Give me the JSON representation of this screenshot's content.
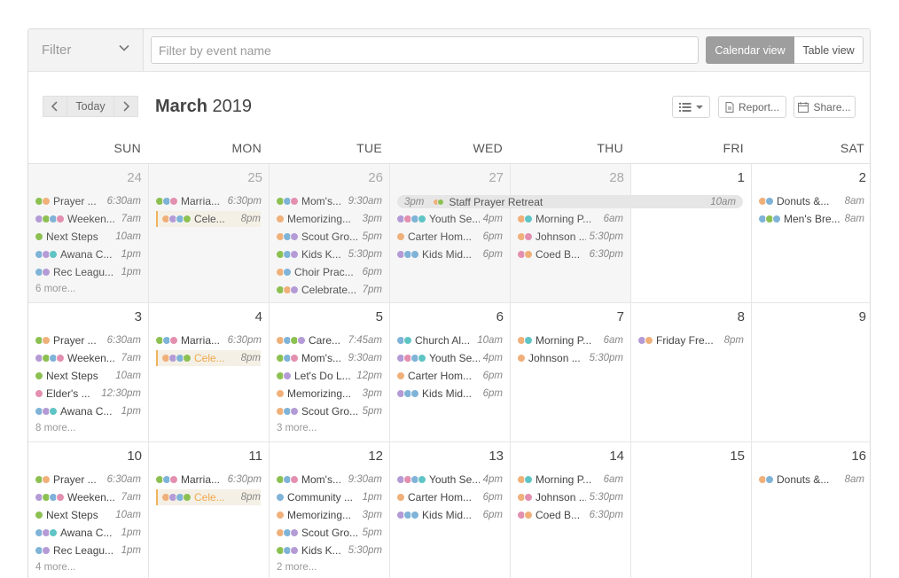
{
  "filter": {
    "label": "Filter",
    "placeholder": "Filter by event name"
  },
  "views": {
    "calendar": "Calendar view",
    "table": "Table view"
  },
  "nav": {
    "prev": "‹",
    "today": "Today",
    "next": "›"
  },
  "month": {
    "name": "March",
    "year": "2019"
  },
  "tools": {
    "list": "≡",
    "report": "Report...",
    "share": "Share..."
  },
  "weekdays": [
    "SUN",
    "MON",
    "TUE",
    "WED",
    "THU",
    "FRI",
    "SAT"
  ],
  "colors": {
    "green": "#8cc152",
    "blue": "#7fb3d8",
    "orange": "#f0b07a",
    "purple": "#b49bd6",
    "teal": "#5fc4c4",
    "pink": "#e38fb0",
    "gray": "#b8b8b8",
    "highlight": "#f0a84a"
  },
  "weeks": [
    {
      "days": [
        {
          "num": "24",
          "past": true,
          "events": [
            {
              "t": "Prayer ...",
              "time": "6:30am",
              "c": [
                "green",
                "orange"
              ]
            },
            {
              "t": "Weeken...",
              "time": "7am",
              "c": [
                "purple",
                "green",
                "blue",
                "pink"
              ]
            },
            {
              "t": "Next Steps",
              "time": "10am",
              "c": [
                "green"
              ]
            },
            {
              "t": "Awana C...",
              "time": "1pm",
              "c": [
                "blue",
                "purple",
                "teal"
              ]
            },
            {
              "t": "Rec Leagu...",
              "time": "1pm",
              "c": [
                "blue",
                "purple"
              ]
            }
          ],
          "more": "6 more..."
        },
        {
          "num": "25",
          "past": true,
          "events": [
            {
              "t": "Marria...",
              "time": "6:30pm",
              "c": [
                "green",
                "blue",
                "pink"
              ]
            },
            {
              "t": "Cele...",
              "time": "8pm",
              "c": [
                "orange",
                "purple",
                "blue",
                "green"
              ],
              "hl": true
            }
          ]
        },
        {
          "num": "26",
          "past": true,
          "events": [
            {
              "t": "Mom's...",
              "time": "9:30am",
              "c": [
                "green",
                "blue",
                "pink"
              ]
            },
            {
              "t": "Memorizing...",
              "time": "3pm",
              "c": [
                "orange"
              ]
            },
            {
              "t": "Scout Gro...",
              "time": "5pm",
              "c": [
                "orange",
                "blue",
                "purple"
              ]
            },
            {
              "t": "Kids K...",
              "time": "5:30pm",
              "c": [
                "green",
                "blue",
                "purple"
              ]
            },
            {
              "t": "Choir Prac...",
              "time": "6pm",
              "c": [
                "orange",
                "blue"
              ]
            },
            {
              "t": "Celebrate...",
              "time": "7pm",
              "c": [
                "green",
                "orange",
                "purple"
              ]
            }
          ]
        },
        {
          "num": "27",
          "past": true,
          "events": [
            {
              "t": "",
              "time": "",
              "c": []
            },
            {
              "t": "Youth Se...",
              "time": "4pm",
              "c": [
                "purple",
                "pink",
                "blue",
                "teal"
              ]
            },
            {
              "t": "Carter Hom...",
              "time": "6pm",
              "c": [
                "orange"
              ]
            },
            {
              "t": "Kids Mid...",
              "time": "6pm",
              "c": [
                "purple",
                "blue",
                "blue"
              ]
            }
          ]
        },
        {
          "num": "28",
          "past": true,
          "events": [
            {
              "t": "",
              "time": "",
              "c": []
            },
            {
              "t": "Morning P...",
              "time": "6am",
              "c": [
                "orange",
                "teal"
              ]
            },
            {
              "t": "Johnson ...",
              "time": "5:30pm",
              "c": [
                "orange",
                "pink"
              ]
            },
            {
              "t": "Coed B...",
              "time": "6:30pm",
              "c": [
                "pink",
                "orange"
              ]
            }
          ]
        },
        {
          "num": "1",
          "past": false,
          "events": []
        },
        {
          "num": "2",
          "past": false,
          "events": [
            {
              "t": "Donuts &...",
              "time": "8am",
              "c": [
                "orange",
                "blue"
              ]
            },
            {
              "t": "Men's Bre...",
              "time": "8am",
              "c": [
                "blue",
                "green",
                "blue"
              ]
            }
          ]
        }
      ]
    },
    {
      "days": [
        {
          "num": "3",
          "past": false,
          "events": [
            {
              "t": "Prayer ...",
              "time": "6:30am",
              "c": [
                "green",
                "orange"
              ]
            },
            {
              "t": "Weeken...",
              "time": "7am",
              "c": [
                "purple",
                "green",
                "blue",
                "pink"
              ]
            },
            {
              "t": "Next Steps",
              "time": "10am",
              "c": [
                "green"
              ]
            },
            {
              "t": "Elder's ...",
              "time": "12:30pm",
              "c": [
                "pink"
              ]
            },
            {
              "t": "Awana C...",
              "time": "1pm",
              "c": [
                "blue",
                "purple",
                "teal"
              ]
            }
          ],
          "more": "8 more..."
        },
        {
          "num": "4",
          "past": false,
          "events": [
            {
              "t": "Marria...",
              "time": "6:30pm",
              "c": [
                "green",
                "blue",
                "pink"
              ]
            },
            {
              "t": "Cele...",
              "time": "8pm",
              "c": [
                "orange",
                "purple",
                "blue",
                "green"
              ],
              "hl": true
            }
          ]
        },
        {
          "num": "5",
          "past": false,
          "events": [
            {
              "t": "Care...",
              "time": "7:45am",
              "c": [
                "orange",
                "blue",
                "green",
                "purple"
              ]
            },
            {
              "t": "Mom's...",
              "time": "9:30am",
              "c": [
                "green",
                "blue",
                "pink"
              ]
            },
            {
              "t": "Let's Do L...",
              "time": "12pm",
              "c": [
                "green",
                "purple"
              ]
            },
            {
              "t": "Memorizing...",
              "time": "3pm",
              "c": [
                "orange"
              ]
            },
            {
              "t": "Scout Gro...",
              "time": "5pm",
              "c": [
                "orange",
                "blue",
                "purple"
              ]
            }
          ],
          "more": "3 more..."
        },
        {
          "num": "6",
          "past": false,
          "events": [
            {
              "t": "Church Al...",
              "time": "10am",
              "c": [
                "blue",
                "teal"
              ]
            },
            {
              "t": "Youth Se...",
              "time": "4pm",
              "c": [
                "purple",
                "pink",
                "blue",
                "teal"
              ]
            },
            {
              "t": "Carter Hom...",
              "time": "6pm",
              "c": [
                "orange"
              ]
            },
            {
              "t": "Kids Mid...",
              "time": "6pm",
              "c": [
                "purple",
                "blue",
                "blue"
              ]
            }
          ]
        },
        {
          "num": "7",
          "past": false,
          "events": [
            {
              "t": "Morning P...",
              "time": "6am",
              "c": [
                "orange",
                "teal"
              ]
            },
            {
              "t": "Johnson ...",
              "time": "5:30pm",
              "c": [
                "orange"
              ]
            }
          ]
        },
        {
          "num": "8",
          "past": false,
          "events": [
            {
              "t": "Friday Fre...",
              "time": "8pm",
              "c": [
                "purple",
                "orange"
              ]
            }
          ]
        },
        {
          "num": "9",
          "past": false,
          "events": []
        }
      ]
    },
    {
      "days": [
        {
          "num": "10",
          "past": false,
          "events": [
            {
              "t": "Prayer ...",
              "time": "6:30am",
              "c": [
                "green",
                "orange"
              ]
            },
            {
              "t": "Weeken...",
              "time": "7am",
              "c": [
                "purple",
                "green",
                "blue",
                "pink"
              ]
            },
            {
              "t": "Next Steps",
              "time": "10am",
              "c": [
                "green"
              ]
            },
            {
              "t": "Awana C...",
              "time": "1pm",
              "c": [
                "blue",
                "purple",
                "teal"
              ]
            },
            {
              "t": "Rec Leagu...",
              "time": "1pm",
              "c": [
                "blue",
                "purple"
              ]
            }
          ],
          "more": "4 more..."
        },
        {
          "num": "11",
          "past": false,
          "events": [
            {
              "t": "Marria...",
              "time": "6:30pm",
              "c": [
                "green",
                "blue",
                "pink"
              ]
            },
            {
              "t": "Cele...",
              "time": "8pm",
              "c": [
                "orange",
                "purple",
                "blue",
                "green"
              ],
              "hl": true
            }
          ]
        },
        {
          "num": "12",
          "past": false,
          "events": [
            {
              "t": "Mom's...",
              "time": "9:30am",
              "c": [
                "green",
                "blue",
                "pink"
              ]
            },
            {
              "t": "Community ...",
              "time": "1pm",
              "c": [
                "blue"
              ]
            },
            {
              "t": "Memorizing...",
              "time": "3pm",
              "c": [
                "orange"
              ]
            },
            {
              "t": "Scout Gro...",
              "time": "5pm",
              "c": [
                "orange",
                "blue",
                "purple"
              ]
            },
            {
              "t": "Kids K...",
              "time": "5:30pm",
              "c": [
                "green",
                "blue",
                "purple"
              ]
            }
          ],
          "more": "2 more..."
        },
        {
          "num": "13",
          "past": false,
          "events": [
            {
              "t": "Youth Se...",
              "time": "4pm",
              "c": [
                "purple",
                "pink",
                "blue",
                "teal"
              ]
            },
            {
              "t": "Carter Hom...",
              "time": "6pm",
              "c": [
                "orange"
              ]
            },
            {
              "t": "Kids Mid...",
              "time": "6pm",
              "c": [
                "purple",
                "blue",
                "blue"
              ]
            }
          ]
        },
        {
          "num": "14",
          "past": false,
          "events": [
            {
              "t": "Morning P...",
              "time": "6am",
              "c": [
                "orange",
                "teal"
              ]
            },
            {
              "t": "Johnson ...",
              "time": "5:30pm",
              "c": [
                "orange",
                "pink"
              ]
            },
            {
              "t": "Coed B...",
              "time": "6:30pm",
              "c": [
                "pink",
                "orange"
              ]
            }
          ]
        },
        {
          "num": "15",
          "past": false,
          "events": []
        },
        {
          "num": "16",
          "past": false,
          "events": [
            {
              "t": "Donuts &...",
              "time": "8am",
              "c": [
                "orange",
                "blue"
              ]
            }
          ]
        }
      ]
    }
  ],
  "retreat": {
    "start": "3pm",
    "title": "Staff Prayer Retreat",
    "end": "10am",
    "c": [
      "orange",
      "green"
    ]
  }
}
